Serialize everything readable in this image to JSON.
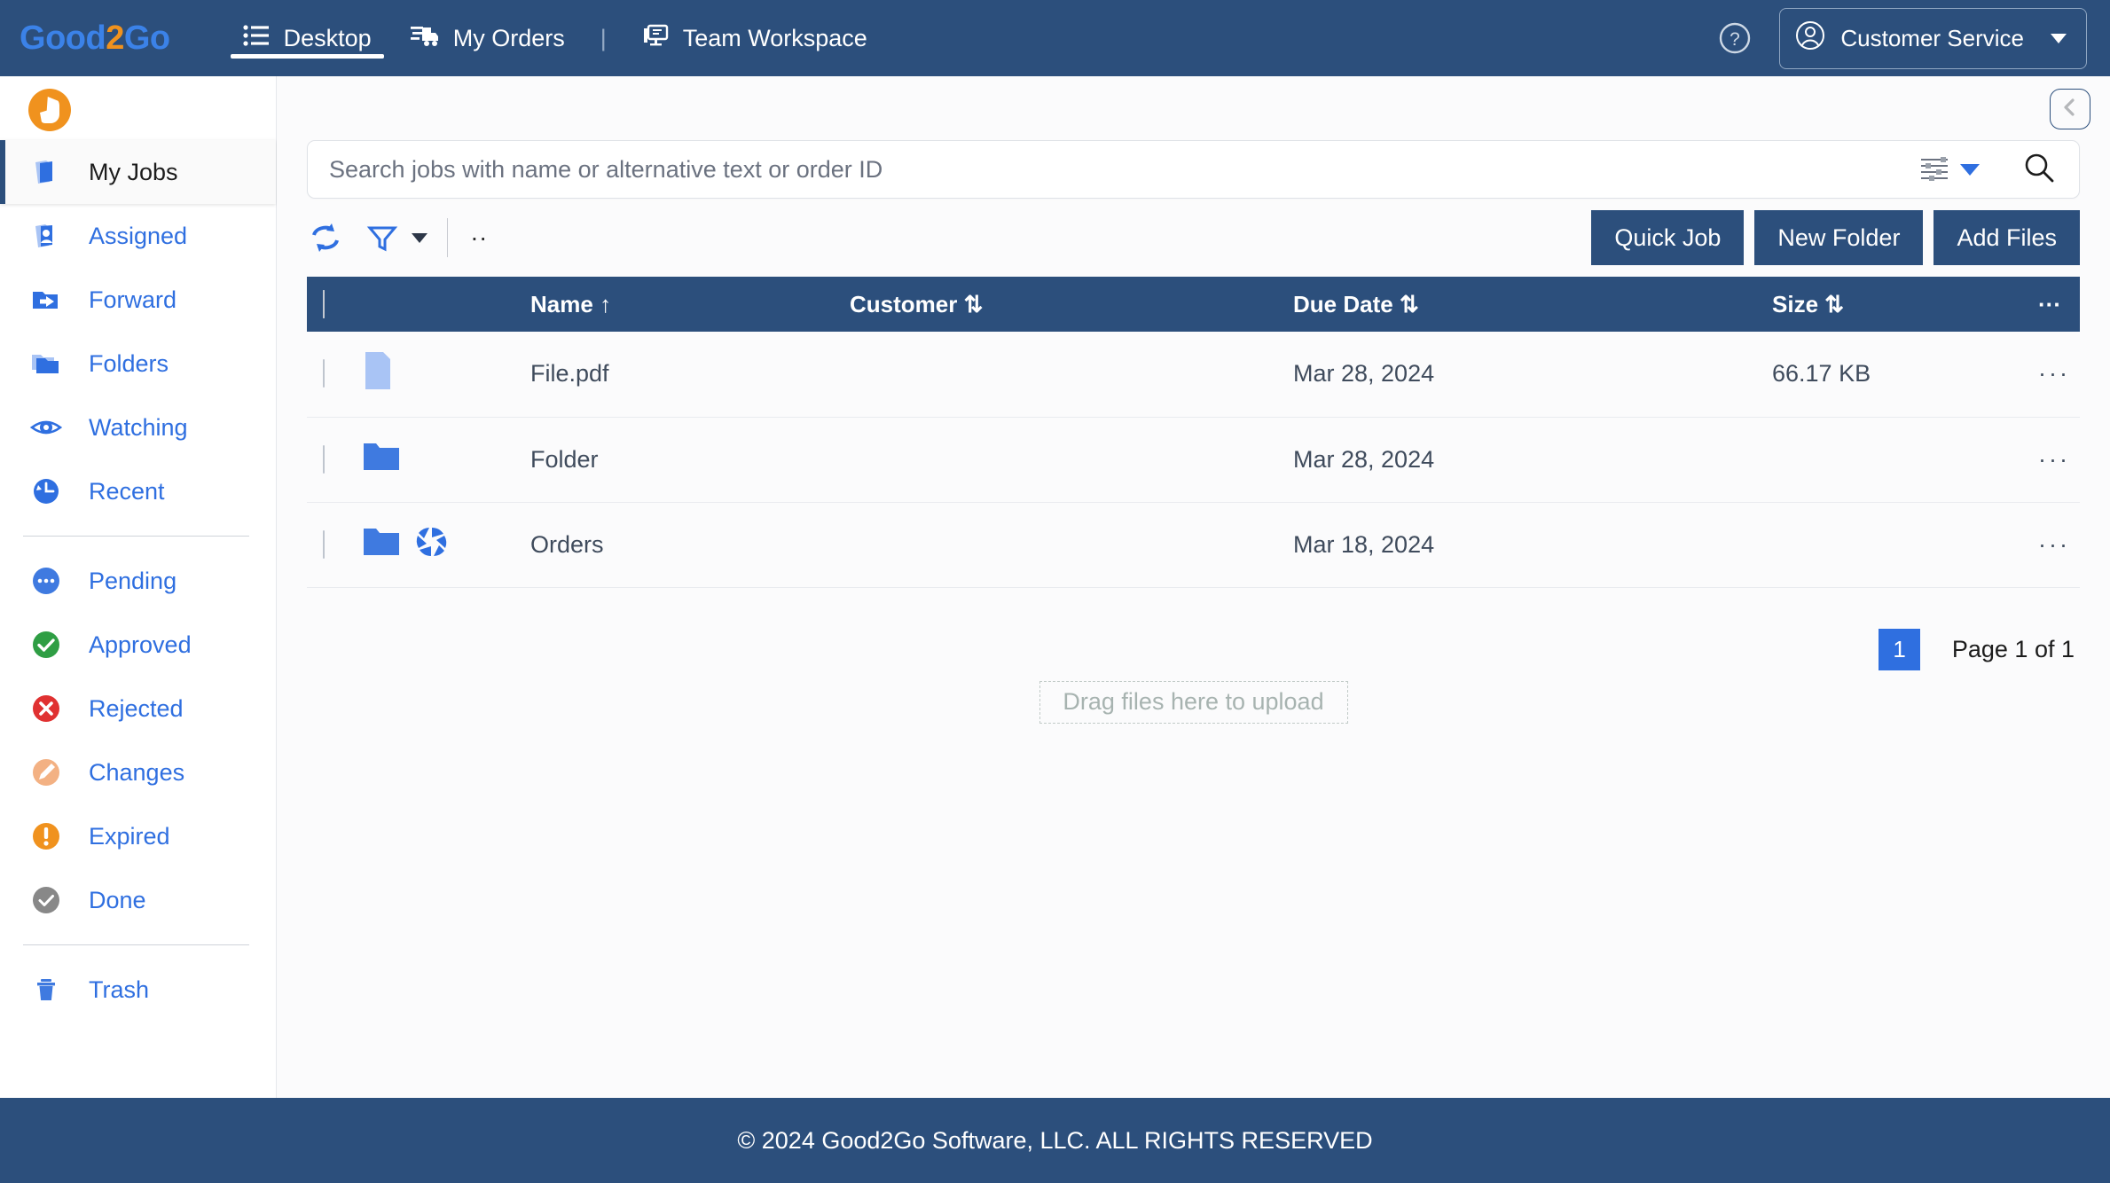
{
  "brand": {
    "name_part1": "G",
    "name_o": "o",
    "name_part2": "od",
    "name_2": "2",
    "name_part3": "Go"
  },
  "topnav": {
    "items": [
      {
        "label": "Desktop",
        "icon": "list-icon",
        "active": true
      },
      {
        "label": "My Orders",
        "icon": "orders-truck-icon",
        "active": false
      },
      {
        "label": "Team Workspace",
        "icon": "workspace-monitor-icon",
        "active": false
      }
    ],
    "separator": "|",
    "help_icon": "question-circle-icon",
    "user": {
      "label": "Customer Service",
      "icon": "user-avatar-icon"
    }
  },
  "sidebar": {
    "logo_icon": "thumbs-up-badge-icon",
    "items": [
      {
        "label": "My Jobs",
        "icon": "my-jobs-icon",
        "active": true
      },
      {
        "label": "Assigned",
        "icon": "assigned-icon",
        "active": false
      },
      {
        "label": "Forward",
        "icon": "forward-icon",
        "active": false
      },
      {
        "label": "Folders",
        "icon": "folders-icon",
        "active": false
      },
      {
        "label": "Watching",
        "icon": "eye-icon",
        "active": false
      },
      {
        "label": "Recent",
        "icon": "recent-clock-icon",
        "active": false
      }
    ],
    "status_items": [
      {
        "label": "Pending",
        "icon": "pending-dots-icon",
        "color": "#3f7ae0"
      },
      {
        "label": "Approved",
        "icon": "approved-check-icon",
        "color": "#2f9e44"
      },
      {
        "label": "Rejected",
        "icon": "rejected-x-icon",
        "color": "#e03131"
      },
      {
        "label": "Changes",
        "icon": "changes-pencil-icon",
        "color": "#f3b183"
      },
      {
        "label": "Expired",
        "icon": "expired-warning-icon",
        "color": "#f0921e"
      },
      {
        "label": "Done",
        "icon": "done-check-icon",
        "color": "#888888"
      }
    ],
    "trash": {
      "label": "Trash",
      "icon": "trash-icon"
    }
  },
  "main": {
    "collapse_icon": "chevron-left-icon",
    "search": {
      "placeholder": "Search jobs with name or alternative text or order ID",
      "value": "",
      "filter_icon": "sliders-filter-icon",
      "search_icon": "magnifier-icon"
    },
    "toolbar": {
      "refresh_icon": "refresh-icon",
      "funnel_icon": "funnel-filter-icon",
      "breadcrumb": "..",
      "quick_job_label": "Quick Job",
      "new_folder_label": "New Folder",
      "add_files_label": "Add Files"
    },
    "table": {
      "headers": [
        {
          "label": "Name",
          "sort": "↑"
        },
        {
          "label": "Customer",
          "sort": "⇅"
        },
        {
          "label": "Due Date",
          "sort": "⇅"
        },
        {
          "label": "Size",
          "sort": "⇅"
        }
      ],
      "menu_header": "···",
      "rows": [
        {
          "name": "File.pdf",
          "kind": "file",
          "customer": "",
          "due_date": "Mar 28, 2024",
          "size": "66.17 KB",
          "menu": "···",
          "badge": ""
        },
        {
          "name": "Folder",
          "kind": "folder",
          "customer": "",
          "due_date": "Mar 28, 2024",
          "size": "",
          "menu": "···",
          "badge": ""
        },
        {
          "name": "Orders",
          "kind": "folder",
          "customer": "",
          "due_date": "Mar 18, 2024",
          "size": "",
          "menu": "···",
          "badge": "aperture-icon"
        }
      ]
    },
    "pagination": {
      "current_page": "1",
      "label": "Page 1 of 1"
    },
    "dropzone": {
      "label": "Drag files here to upload"
    }
  },
  "footer": {
    "copyright": "© 2024 Good2Go Software, LLC. ALL RIGHTS RESERVED"
  },
  "colors": {
    "navy": "#2c4f7c",
    "accent_blue": "#2f6fe0",
    "brand_orange": "#f0921e",
    "file_text": "#5a2119",
    "folder_text": "#1d3d6e"
  }
}
